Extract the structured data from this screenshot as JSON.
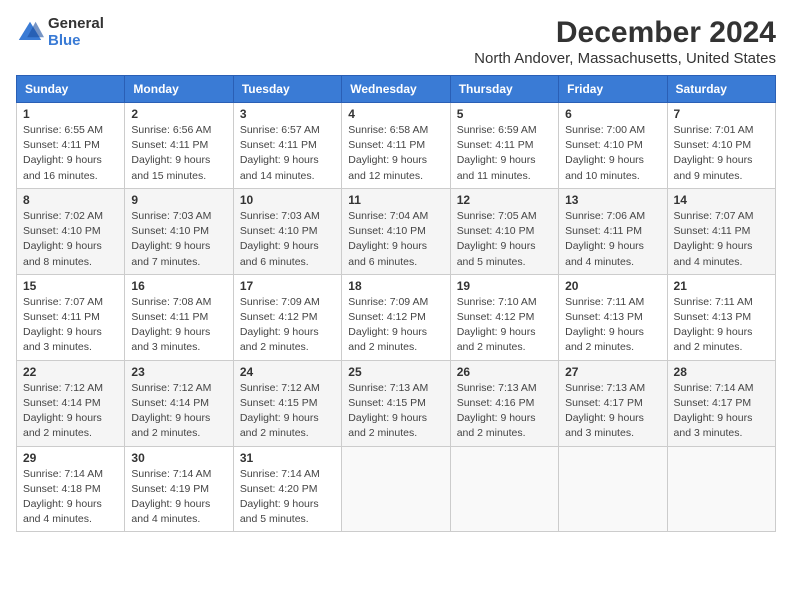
{
  "logo": {
    "general": "General",
    "blue": "Blue"
  },
  "title": "December 2024",
  "subtitle": "North Andover, Massachusetts, United States",
  "weekdays": [
    "Sunday",
    "Monday",
    "Tuesday",
    "Wednesday",
    "Thursday",
    "Friday",
    "Saturday"
  ],
  "weeks": [
    [
      {
        "day": "1",
        "info": "Sunrise: 6:55 AM\nSunset: 4:11 PM\nDaylight: 9 hours and 16 minutes."
      },
      {
        "day": "2",
        "info": "Sunrise: 6:56 AM\nSunset: 4:11 PM\nDaylight: 9 hours and 15 minutes."
      },
      {
        "day": "3",
        "info": "Sunrise: 6:57 AM\nSunset: 4:11 PM\nDaylight: 9 hours and 14 minutes."
      },
      {
        "day": "4",
        "info": "Sunrise: 6:58 AM\nSunset: 4:11 PM\nDaylight: 9 hours and 12 minutes."
      },
      {
        "day": "5",
        "info": "Sunrise: 6:59 AM\nSunset: 4:11 PM\nDaylight: 9 hours and 11 minutes."
      },
      {
        "day": "6",
        "info": "Sunrise: 7:00 AM\nSunset: 4:10 PM\nDaylight: 9 hours and 10 minutes."
      },
      {
        "day": "7",
        "info": "Sunrise: 7:01 AM\nSunset: 4:10 PM\nDaylight: 9 hours and 9 minutes."
      }
    ],
    [
      {
        "day": "8",
        "info": "Sunrise: 7:02 AM\nSunset: 4:10 PM\nDaylight: 9 hours and 8 minutes."
      },
      {
        "day": "9",
        "info": "Sunrise: 7:03 AM\nSunset: 4:10 PM\nDaylight: 9 hours and 7 minutes."
      },
      {
        "day": "10",
        "info": "Sunrise: 7:03 AM\nSunset: 4:10 PM\nDaylight: 9 hours and 6 minutes."
      },
      {
        "day": "11",
        "info": "Sunrise: 7:04 AM\nSunset: 4:10 PM\nDaylight: 9 hours and 6 minutes."
      },
      {
        "day": "12",
        "info": "Sunrise: 7:05 AM\nSunset: 4:10 PM\nDaylight: 9 hours and 5 minutes."
      },
      {
        "day": "13",
        "info": "Sunrise: 7:06 AM\nSunset: 4:11 PM\nDaylight: 9 hours and 4 minutes."
      },
      {
        "day": "14",
        "info": "Sunrise: 7:07 AM\nSunset: 4:11 PM\nDaylight: 9 hours and 4 minutes."
      }
    ],
    [
      {
        "day": "15",
        "info": "Sunrise: 7:07 AM\nSunset: 4:11 PM\nDaylight: 9 hours and 3 minutes."
      },
      {
        "day": "16",
        "info": "Sunrise: 7:08 AM\nSunset: 4:11 PM\nDaylight: 9 hours and 3 minutes."
      },
      {
        "day": "17",
        "info": "Sunrise: 7:09 AM\nSunset: 4:12 PM\nDaylight: 9 hours and 2 minutes."
      },
      {
        "day": "18",
        "info": "Sunrise: 7:09 AM\nSunset: 4:12 PM\nDaylight: 9 hours and 2 minutes."
      },
      {
        "day": "19",
        "info": "Sunrise: 7:10 AM\nSunset: 4:12 PM\nDaylight: 9 hours and 2 minutes."
      },
      {
        "day": "20",
        "info": "Sunrise: 7:11 AM\nSunset: 4:13 PM\nDaylight: 9 hours and 2 minutes."
      },
      {
        "day": "21",
        "info": "Sunrise: 7:11 AM\nSunset: 4:13 PM\nDaylight: 9 hours and 2 minutes."
      }
    ],
    [
      {
        "day": "22",
        "info": "Sunrise: 7:12 AM\nSunset: 4:14 PM\nDaylight: 9 hours and 2 minutes."
      },
      {
        "day": "23",
        "info": "Sunrise: 7:12 AM\nSunset: 4:14 PM\nDaylight: 9 hours and 2 minutes."
      },
      {
        "day": "24",
        "info": "Sunrise: 7:12 AM\nSunset: 4:15 PM\nDaylight: 9 hours and 2 minutes."
      },
      {
        "day": "25",
        "info": "Sunrise: 7:13 AM\nSunset: 4:15 PM\nDaylight: 9 hours and 2 minutes."
      },
      {
        "day": "26",
        "info": "Sunrise: 7:13 AM\nSunset: 4:16 PM\nDaylight: 9 hours and 2 minutes."
      },
      {
        "day": "27",
        "info": "Sunrise: 7:13 AM\nSunset: 4:17 PM\nDaylight: 9 hours and 3 minutes."
      },
      {
        "day": "28",
        "info": "Sunrise: 7:14 AM\nSunset: 4:17 PM\nDaylight: 9 hours and 3 minutes."
      }
    ],
    [
      {
        "day": "29",
        "info": "Sunrise: 7:14 AM\nSunset: 4:18 PM\nDaylight: 9 hours and 4 minutes."
      },
      {
        "day": "30",
        "info": "Sunrise: 7:14 AM\nSunset: 4:19 PM\nDaylight: 9 hours and 4 minutes."
      },
      {
        "day": "31",
        "info": "Sunrise: 7:14 AM\nSunset: 4:20 PM\nDaylight: 9 hours and 5 minutes."
      },
      null,
      null,
      null,
      null
    ]
  ]
}
